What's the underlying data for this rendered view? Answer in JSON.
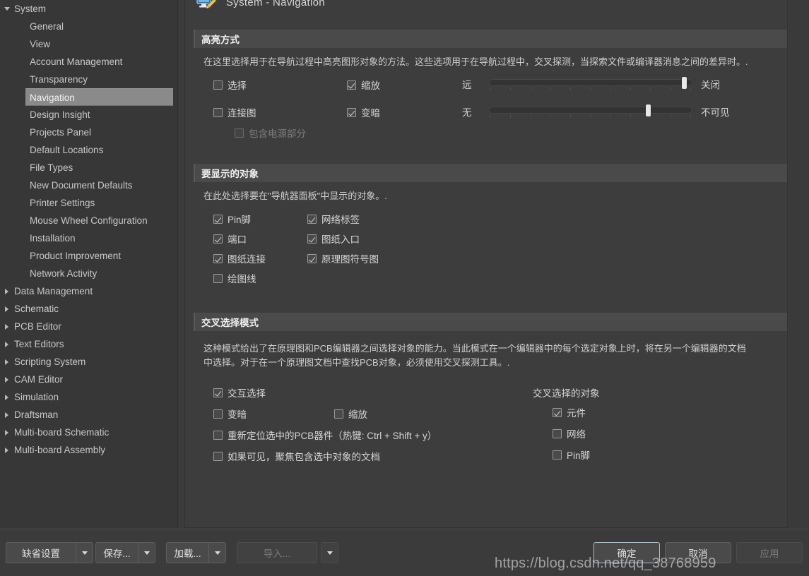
{
  "header": {
    "title": "System - Navigation",
    "icon": "monitor-pencil-icon"
  },
  "sidebar": {
    "items": [
      {
        "label": "System",
        "level": 0,
        "expanded": true,
        "selected": false
      },
      {
        "label": "General",
        "level": 1,
        "selected": false
      },
      {
        "label": "View",
        "level": 1,
        "selected": false
      },
      {
        "label": "Account Management",
        "level": 1,
        "selected": false
      },
      {
        "label": "Transparency",
        "level": 1,
        "selected": false
      },
      {
        "label": "Navigation",
        "level": 1,
        "selected": true
      },
      {
        "label": "Design Insight",
        "level": 1,
        "selected": false
      },
      {
        "label": "Projects Panel",
        "level": 1,
        "selected": false
      },
      {
        "label": "Default Locations",
        "level": 1,
        "selected": false
      },
      {
        "label": "File Types",
        "level": 1,
        "selected": false
      },
      {
        "label": "New Document Defaults",
        "level": 1,
        "selected": false
      },
      {
        "label": "Printer Settings",
        "level": 1,
        "selected": false
      },
      {
        "label": "Mouse Wheel Configuration",
        "level": 1,
        "selected": false
      },
      {
        "label": "Installation",
        "level": 1,
        "selected": false
      },
      {
        "label": "Product Improvement",
        "level": 1,
        "selected": false
      },
      {
        "label": "Network Activity",
        "level": 1,
        "selected": false
      },
      {
        "label": "Data Management",
        "level": 0,
        "expanded": false,
        "selected": false
      },
      {
        "label": "Schematic",
        "level": 0,
        "expanded": false,
        "selected": false
      },
      {
        "label": "PCB Editor",
        "level": 0,
        "expanded": false,
        "selected": false
      },
      {
        "label": "Text Editors",
        "level": 0,
        "expanded": false,
        "selected": false
      },
      {
        "label": "Scripting System",
        "level": 0,
        "expanded": false,
        "selected": false
      },
      {
        "label": "CAM Editor",
        "level": 0,
        "expanded": false,
        "selected": false
      },
      {
        "label": "Simulation",
        "level": 0,
        "expanded": false,
        "selected": false
      },
      {
        "label": "Draftsman",
        "level": 0,
        "expanded": false,
        "selected": false
      },
      {
        "label": "Multi-board Schematic",
        "level": 0,
        "expanded": false,
        "selected": false
      },
      {
        "label": "Multi-board Assembly",
        "level": 0,
        "expanded": false,
        "selected": false
      }
    ]
  },
  "highlight_section": {
    "title": "高亮方式",
    "description": "在这里选择用于在导航过程中高亮图形对象的方法。这些选项用于在导航过程中，交叉探测，当探索文件或编译器消息之间的差异时。.",
    "checkboxes": [
      {
        "label": "选择",
        "checked": false,
        "disabled": false
      },
      {
        "label": "缩放",
        "checked": true,
        "disabled": false
      },
      {
        "label": "连接图",
        "checked": false,
        "disabled": false
      },
      {
        "label": "变暗",
        "checked": true,
        "disabled": false
      },
      {
        "label": "包含电源部分",
        "checked": false,
        "disabled": true
      }
    ],
    "sliders": [
      {
        "left_label": "远",
        "right_label": "关闭",
        "value": 97,
        "ticks": 11
      },
      {
        "left_label": "无",
        "right_label": "不可见",
        "value": 79,
        "ticks": 11
      }
    ]
  },
  "objects_section": {
    "title": "要显示的对象",
    "description": "在此处选择要在\"导航器面板\"中显示的对象。.",
    "col1": [
      {
        "label": "Pin脚",
        "checked": true
      },
      {
        "label": "端口",
        "checked": true
      },
      {
        "label": "图纸连接",
        "checked": true
      },
      {
        "label": "绘图线",
        "checked": false
      }
    ],
    "col2": [
      {
        "label": "网络标签",
        "checked": true
      },
      {
        "label": "图纸入口",
        "checked": true
      },
      {
        "label": "原理图符号图",
        "checked": true
      }
    ]
  },
  "crossselect_section": {
    "title": "交叉选择模式",
    "description": "这种模式给出了在原理图和PCB编辑器之间选择对象的能力。当此模式在一个编辑器中的每个选定对象上时，将在另一个编辑器的文档中选择。对于在一个原理图文档中查找PCB对象，必须使用交叉探测工具。.",
    "main_checkbox": {
      "label": "交互选择",
      "checked": true
    },
    "sub_row": [
      {
        "label": "变暗",
        "checked": false
      },
      {
        "label": "缩放",
        "checked": false
      }
    ],
    "rows": [
      {
        "label": "重新定位选中的PCB器件（热键: Ctrl + Shift + y）",
        "checked": false
      },
      {
        "label": "如果可见，聚焦包含选中对象的文档",
        "checked": false
      }
    ],
    "right_title": "交叉选择的对象",
    "right_items": [
      {
        "label": "元件",
        "checked": true
      },
      {
        "label": "网络",
        "checked": false
      },
      {
        "label": "Pin脚",
        "checked": false
      }
    ]
  },
  "footer": {
    "default_settings": "缺省设置",
    "save": "保存...",
    "load": "加载...",
    "import": "导入...",
    "ok": "确定",
    "cancel": "取消",
    "apply": "应用"
  },
  "watermark": "https://blog.csdn.net/qq_38768959"
}
